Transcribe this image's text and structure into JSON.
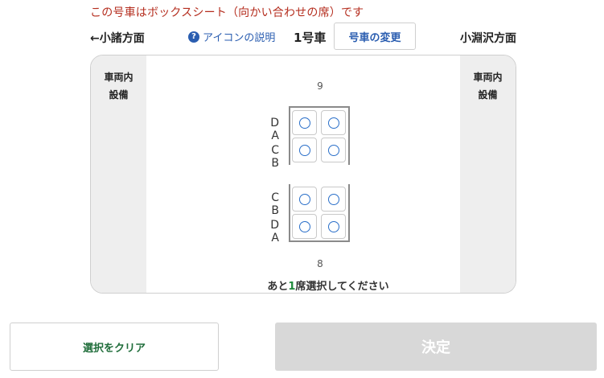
{
  "notice": "この号車はボックスシート（向かい合わせの席）です",
  "header": {
    "direction_left": "←小諸方面",
    "icon_help_label": "アイコンの説明",
    "car_number": "1号車",
    "change_car_label": "号車の変更",
    "direction_right": "小淵沢方面"
  },
  "car": {
    "facility_left": [
      "車両内",
      "設備"
    ],
    "facility_right": [
      "車両内",
      "設備"
    ],
    "row_top": "9",
    "row_bottom": "8",
    "seat_rows": [
      {
        "label": "D A",
        "seats": [
          "available",
          "available"
        ]
      },
      {
        "label": "C B",
        "seats": [
          "available",
          "available"
        ]
      },
      {
        "label": "C B",
        "seats": [
          "available",
          "available"
        ]
      },
      {
        "label": "D A",
        "seats": [
          "available",
          "available"
        ]
      }
    ],
    "remaining_prefix": "あと",
    "remaining_count": "1",
    "remaining_suffix": "席選択してください"
  },
  "actions": {
    "clear_label": "選択をクリア",
    "decide_label": "決定"
  },
  "colors": {
    "notice": "#b52e1f",
    "link": "#2a5db0",
    "seat_ring": "#2a6fc9",
    "count_highlight": "#1f8a3c",
    "clear_text": "#1f6d3a",
    "disabled_button": "#d8d8d8"
  }
}
